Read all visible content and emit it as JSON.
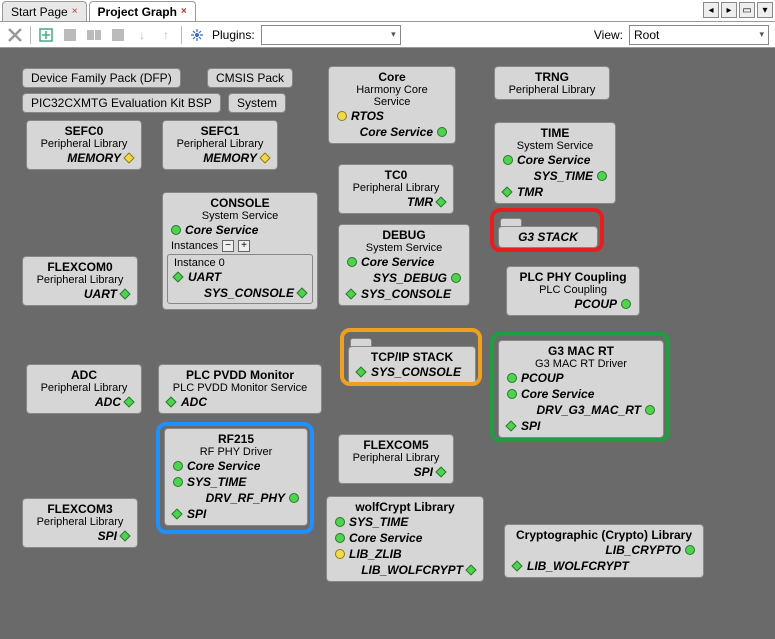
{
  "tabs": {
    "start": "Start Page",
    "projectGraph": "Project Graph"
  },
  "toolbar": {
    "pluginsLabel": "Plugins:",
    "viewLabel": "View:",
    "viewValue": "Root"
  },
  "pills": {
    "dfp": "Device Family Pack (DFP)",
    "cmsis": "CMSIS Pack",
    "bsp": "PIC32CXMTG Evaluation Kit BSP",
    "system": "System"
  },
  "blocks": {
    "core": {
      "title": "Core",
      "sub": "Harmony Core Service",
      "p1": "RTOS",
      "p2": "Core Service"
    },
    "trng": {
      "title": "TRNG",
      "sub": "Peripheral Library"
    },
    "sefc0": {
      "title": "SEFC0",
      "sub": "Peripheral Library",
      "p1": "MEMORY"
    },
    "sefc1": {
      "title": "SEFC1",
      "sub": "Peripheral Library",
      "p1": "MEMORY"
    },
    "time": {
      "title": "TIME",
      "sub": "System Service",
      "p1": "Core Service",
      "p2": "SYS_TIME",
      "p3": "TMR"
    },
    "tc0": {
      "title": "TC0",
      "sub": "Peripheral Library",
      "p1": "TMR"
    },
    "console": {
      "title": "CONSOLE",
      "sub": "System Service",
      "p1": "Core Service",
      "instances": "Instances",
      "inst0": "Instance 0",
      "uart": "UART",
      "syscon": "SYS_CONSOLE"
    },
    "flexcom0": {
      "title": "FLEXCOM0",
      "sub": "Peripheral Library",
      "p1": "UART"
    },
    "debug": {
      "title": "DEBUG",
      "sub": "System Service",
      "p1": "Core Service",
      "p2": "SYS_DEBUG",
      "p3": "SYS_CONSOLE"
    },
    "g3stack": {
      "title": "G3 STACK"
    },
    "plcphy": {
      "title": "PLC PHY Coupling",
      "sub": "PLC Coupling",
      "p1": "PCOUP"
    },
    "tcpip": {
      "title": "TCP/IP STACK",
      "p1": "SYS_CONSOLE"
    },
    "adc": {
      "title": "ADC",
      "sub": "Peripheral Library",
      "p1": "ADC"
    },
    "pvdd": {
      "title": "PLC PVDD Monitor",
      "sub": "PLC PVDD Monitor Service",
      "p1": "ADC"
    },
    "g3mac": {
      "title": "G3 MAC RT",
      "sub": "G3 MAC RT Driver",
      "p1": "PCOUP",
      "p2": "Core Service",
      "p3": "DRV_G3_MAC_RT",
      "p4": "SPI"
    },
    "rf215": {
      "title": "RF215",
      "sub": "RF PHY Driver",
      "p1": "Core Service",
      "p2": "SYS_TIME",
      "p3": "DRV_RF_PHY",
      "p4": "SPI"
    },
    "flexcom5": {
      "title": "FLEXCOM5",
      "sub": "Peripheral Library",
      "p1": "SPI"
    },
    "flexcom3": {
      "title": "FLEXCOM3",
      "sub": "Peripheral Library",
      "p1": "SPI"
    },
    "wolfcrypt": {
      "title": "wolfCrypt Library",
      "p1": "SYS_TIME",
      "p2": "Core Service",
      "p3": "LIB_ZLIB",
      "p4": "LIB_WOLFCRYPT"
    },
    "crypto": {
      "title": "Cryptographic (Crypto) Library",
      "p1": "LIB_CRYPTO",
      "p2": "LIB_WOLFCRYPT"
    }
  }
}
